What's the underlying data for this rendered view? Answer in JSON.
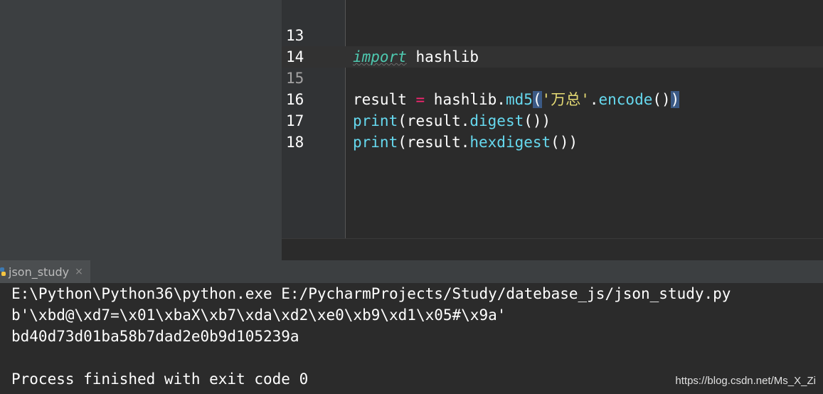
{
  "editor": {
    "lines": [
      {
        "num": "13",
        "tokens": {
          "t1": "import",
          "t2": " hashlib"
        }
      },
      {
        "num": "14"
      },
      {
        "num": "15",
        "tokens": {
          "t1": "result",
          "t2": " = ",
          "t3": "hashlib.",
          "t4": "md5",
          "t5": "(",
          "t6": "'万总'",
          "t7": ".",
          "t8": "encode",
          "t9": "()",
          "t10": ")"
        }
      },
      {
        "num": "16",
        "tokens": {
          "t1": "print",
          "t2": "(result.",
          "t3": "digest",
          "t4": "())"
        }
      },
      {
        "num": "17",
        "tokens": {
          "t1": "print",
          "t2": "(result.",
          "t3": "hexdigest",
          "t4": "())"
        }
      },
      {
        "num": "18"
      }
    ]
  },
  "run_tab": {
    "label": "json_study",
    "close": "×"
  },
  "console": {
    "lines": [
      "E:\\Python\\Python36\\python.exe E:/PycharmProjects/Study/datebase_js/json_study.py",
      "b'\\xbd@\\xd7=\\x01\\xbaX\\xb7\\xda\\xd2\\xe0\\xb9\\xd1\\x05#\\x9a'",
      "bd40d73d01ba58b7dad2e0b9d105239a",
      "",
      "Process finished with exit code 0"
    ]
  },
  "watermark": "https://blog.csdn.net/Ms_X_Zi",
  "colors": {
    "background": "#2b2b2b",
    "sidebar": "#3c3f41",
    "keyword": "#4ec9b0",
    "function": "#66d9ef",
    "operator": "#f92672",
    "string": "#e6db74",
    "bracket_highlight": "#3b5a86"
  }
}
